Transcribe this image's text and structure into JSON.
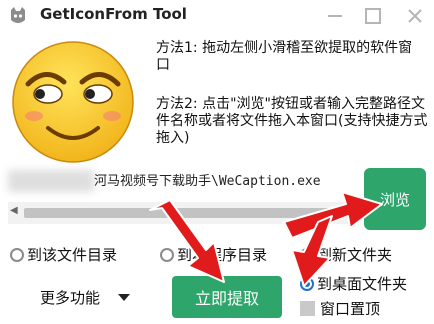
{
  "window": {
    "title": "GetIconFrom Tool",
    "controls": {
      "minimize_icon": "minimize-icon",
      "maximize_icon": "maximize-icon",
      "close_icon": "close-icon"
    }
  },
  "instructions": {
    "method1": "方法1: 拖动左侧小滑稽至欲提取的软件窗口",
    "method2": "方法2: 点击\"浏览\"按钮或者输入完整路径文件名称或者将文件拖入本窗口(支持快捷方式拖入)"
  },
  "path_input": {
    "value": "河马视频号下载助手\\WeCaption.exe"
  },
  "browse_label": "浏览",
  "options": {
    "target_dir": "到该文件目录",
    "program_dir": "到本程序目录",
    "new_folder": "到新文件夹",
    "desktop_folder": "到桌面文件夹",
    "selected": "desktop_folder"
  },
  "more_label": "更多功能",
  "extract_label": "立即提取",
  "topmost_label": "窗口置顶",
  "colors": {
    "accent": "#2ea66b",
    "arrow": "#e11b1b",
    "radio_checked": "#1f6fd1"
  }
}
